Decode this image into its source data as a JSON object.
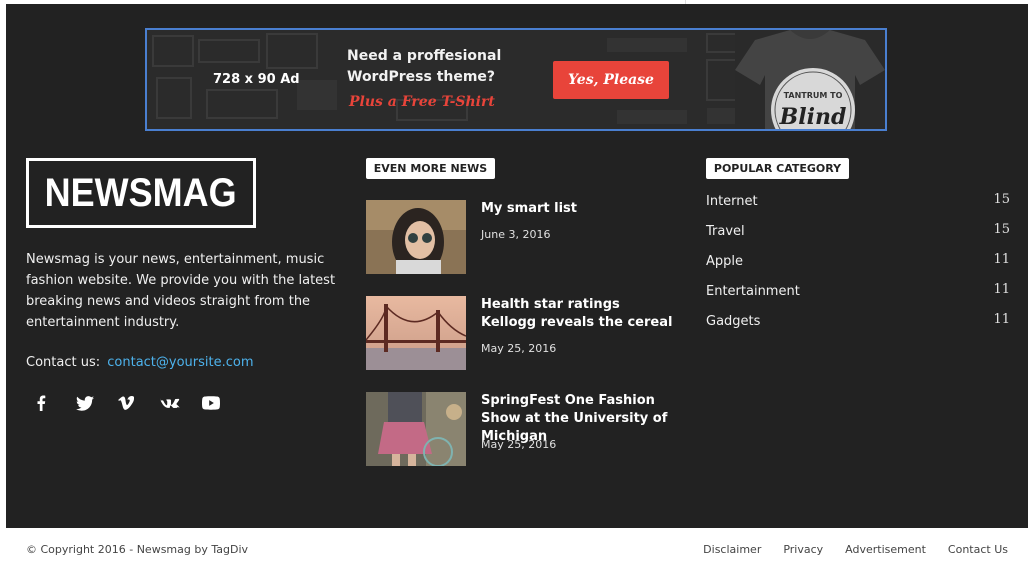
{
  "ad": {
    "size_label": "728 x 90 Ad",
    "line1": "Need a proffesional",
    "line2": "WordPress theme?",
    "promo": "Plus a Free T-Shirt",
    "button_label": "Yes, Please",
    "shirt_text": "TANTRUM TO",
    "shirt_text2": "Blind"
  },
  "logo": {
    "text": "NEWSMAG"
  },
  "about": {
    "description": "Newsmag is your news, entertainment, music fashion website. We provide you with the latest breaking news and videos straight from the entertainment industry.",
    "contact_label": "Contact us:",
    "contact_email": "contact@yoursite.com"
  },
  "social": {
    "icons": [
      "facebook-icon",
      "twitter-icon",
      "vimeo-icon",
      "vk-icon",
      "youtube-icon"
    ]
  },
  "even_more_news": {
    "title": "EVEN MORE NEWS",
    "items": [
      {
        "title": "My smart list",
        "date": "June 3, 2016"
      },
      {
        "title": "Health star ratings Kellogg reveals the cereal",
        "date": "May 25, 2016"
      },
      {
        "title": "SpringFest One Fashion Show at the University of Michigan",
        "date": "May 25, 2016"
      }
    ]
  },
  "popular_category": {
    "title": "POPULAR CATEGORY",
    "items": [
      {
        "name": "Internet",
        "count": "15"
      },
      {
        "name": "Travel",
        "count": "15"
      },
      {
        "name": "Apple",
        "count": "11"
      },
      {
        "name": "Entertainment",
        "count": "11"
      },
      {
        "name": "Gadgets",
        "count": "11"
      }
    ]
  },
  "sub_footer": {
    "copyright": "© Copyright 2016 - Newsmag by TagDiv",
    "menu": [
      "Disclaimer",
      "Privacy",
      "Advertisement",
      "Contact Us"
    ]
  },
  "colors": {
    "footer_bg": "#222222",
    "accent_blue": "#4db2ec",
    "ad_button": "#e8443a",
    "ad_border": "#4a7fd0"
  }
}
